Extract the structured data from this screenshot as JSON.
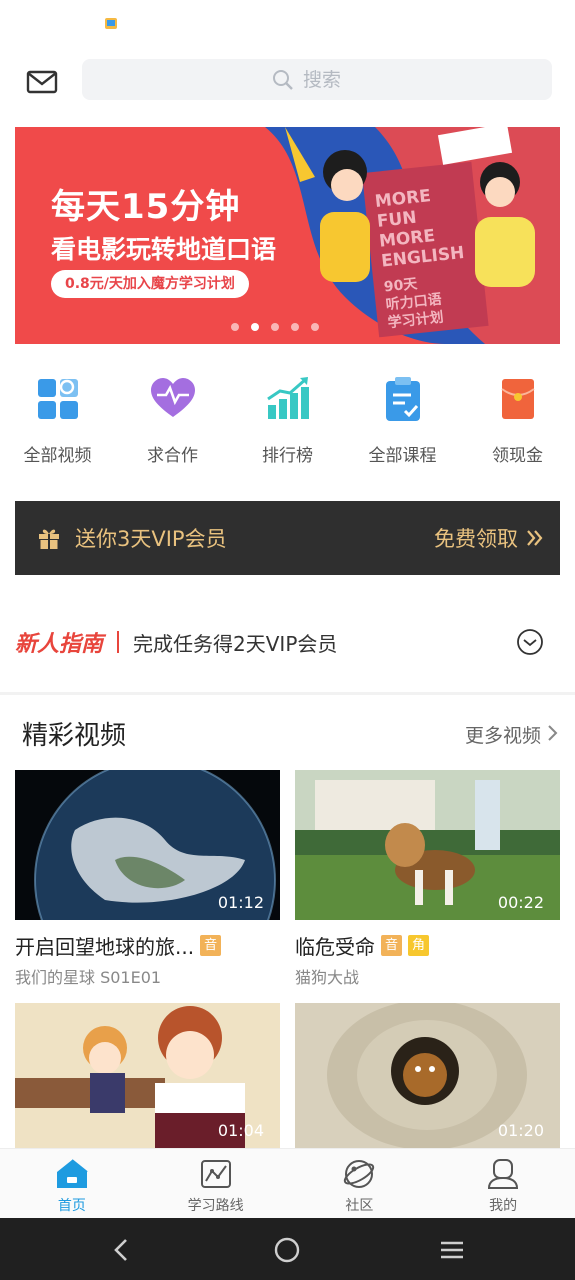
{
  "header": {
    "search_placeholder": "搜索"
  },
  "banner": {
    "headline": "每天15分钟",
    "subline": "看电影玩转地道口语",
    "pill": "0.8元/天加入魔方学习计划",
    "book_lines": [
      "MORE",
      "FUN",
      "MORE",
      "ENGLISH",
      "90天",
      "听力口语",
      "学习计划"
    ],
    "slide_count": 5,
    "active_slide": 2
  },
  "quick_nav": [
    {
      "label": "全部视频",
      "icon": "video-grid-icon",
      "color": "#3a9ae8"
    },
    {
      "label": "求合作",
      "icon": "heart-pulse-icon",
      "color": "#a46ee0"
    },
    {
      "label": "排行榜",
      "icon": "ranking-chart-icon",
      "color": "#38c8c4"
    },
    {
      "label": "全部课程",
      "icon": "clipboard-check-icon",
      "color": "#3a9ae8"
    },
    {
      "label": "领现金",
      "icon": "red-envelope-icon",
      "color": "#f0643c"
    }
  ],
  "vip": {
    "text": "送你3天VIP会员",
    "claim": "免费领取"
  },
  "newbie": {
    "tag": "新人指南",
    "task": "完成任务得2天VIP会员"
  },
  "videos_section": {
    "title": "精彩视频",
    "more": "更多视频",
    "items": [
      {
        "title": "开启回望地球的旅...",
        "subtitle": "我们的星球 S01E01",
        "duration": "01:12",
        "badges": [
          "音"
        ]
      },
      {
        "title": "临危受命",
        "subtitle": "猫狗大战",
        "duration": "00:22",
        "badges": [
          "音",
          "角"
        ]
      },
      {
        "title": "",
        "subtitle": "",
        "duration": "01:04",
        "badges": []
      },
      {
        "title": "",
        "subtitle": "",
        "duration": "01:20",
        "badges": []
      }
    ]
  },
  "tabs": [
    {
      "label": "首页",
      "active": true
    },
    {
      "label": "学习路线",
      "active": false
    },
    {
      "label": "社区",
      "active": false
    },
    {
      "label": "我的",
      "active": false
    }
  ],
  "colors": {
    "accent": "#1e9be0",
    "vip_gold": "#e9c27f",
    "banner_red": "#f04a4a",
    "newbie_red": "#e8453c"
  }
}
